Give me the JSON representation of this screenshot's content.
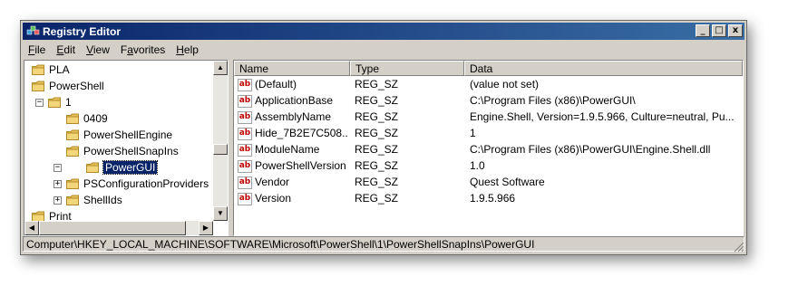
{
  "window": {
    "title": "Registry Editor",
    "minimize": "_",
    "maximize": "□",
    "close": "x"
  },
  "menu": [
    {
      "accel": "F",
      "rest": "ile"
    },
    {
      "accel": "E",
      "rest": "dit"
    },
    {
      "accel": "V",
      "rest": "iew"
    },
    {
      "accel": "",
      "pre": "F",
      "accel2": "a",
      "rest": "vorites"
    },
    {
      "accel": "H",
      "rest": "elp"
    }
  ],
  "tree": {
    "items": [
      "PLA",
      "PowerShell",
      "1",
      "0409",
      "PowerShellEngine",
      "PowerShellSnapIns",
      "PowerGUI",
      "PSConfigurationProviders",
      "ShellIds",
      "Print"
    ],
    "expanded_mark": "−",
    "collapsed_mark": "+"
  },
  "list": {
    "columns": [
      "Name",
      "Type",
      "Data"
    ],
    "icon_text": "ab",
    "rows": [
      {
        "name": "(Default)",
        "type": "REG_SZ",
        "data": "(value not set)"
      },
      {
        "name": "ApplicationBase",
        "type": "REG_SZ",
        "data": "C:\\Program Files (x86)\\PowerGUI\\"
      },
      {
        "name": "AssemblyName",
        "type": "REG_SZ",
        "data": "Engine.Shell, Version=1.9.5.966, Culture=neutral, Pu..."
      },
      {
        "name": "Hide_7B2E7C508...",
        "type": "REG_SZ",
        "data": "1"
      },
      {
        "name": "ModuleName",
        "type": "REG_SZ",
        "data": "C:\\Program Files (x86)\\PowerGUI\\Engine.Shell.dll"
      },
      {
        "name": "PowerShellVersion",
        "type": "REG_SZ",
        "data": "1.0"
      },
      {
        "name": "Vendor",
        "type": "REG_SZ",
        "data": "Quest Software"
      },
      {
        "name": "Version",
        "type": "REG_SZ",
        "data": "1.9.5.966"
      }
    ]
  },
  "status": {
    "path": "Computer\\HKEY_LOCAL_MACHINE\\SOFTWARE\\Microsoft\\PowerShell\\1\\PowerShellSnapIns\\PowerGUI"
  },
  "colors": {
    "title_start": "#0a246a",
    "title_end": "#3a6ea5",
    "selection": "#0a246a",
    "folder": "#e8c15a",
    "string_icon": "#c00000"
  }
}
